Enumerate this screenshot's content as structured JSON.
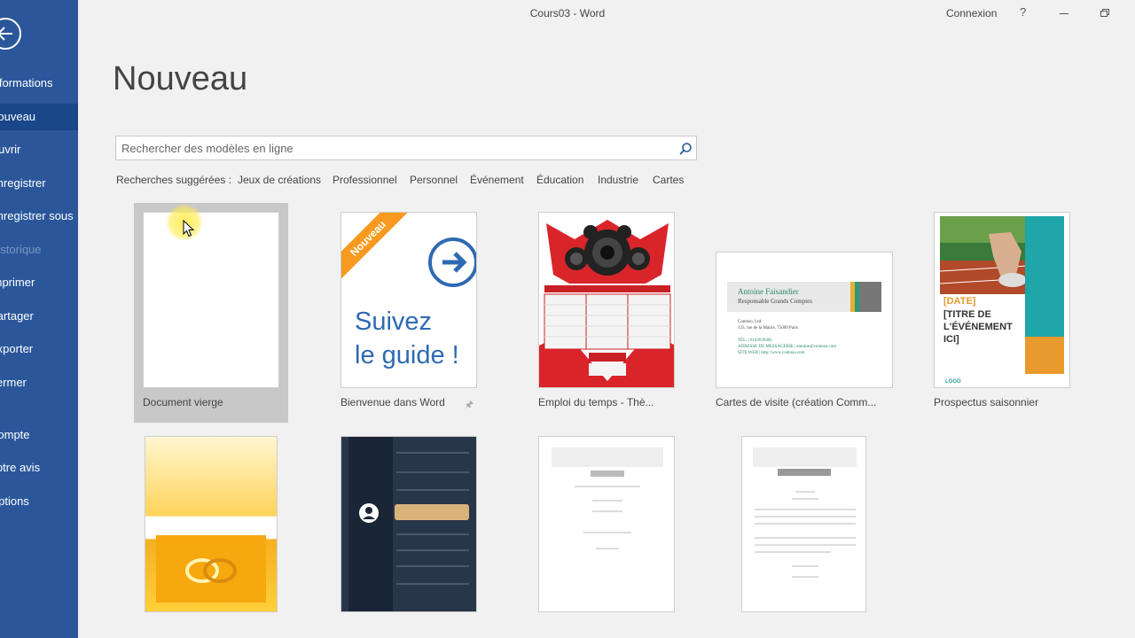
{
  "window": {
    "title": "Cours03  -  Word",
    "account": "Connexion",
    "help": "?"
  },
  "sidebar": {
    "items": [
      {
        "label": "Informations"
      },
      {
        "label": "Nouveau"
      },
      {
        "label": "Ouvrir"
      },
      {
        "label": "Enregistrer"
      },
      {
        "label": "Enregistrer sous"
      },
      {
        "label": "Historique"
      },
      {
        "label": "Imprimer"
      },
      {
        "label": "Partager"
      },
      {
        "label": "Exporter"
      },
      {
        "label": "Fermer"
      },
      {
        "label": "Compte"
      },
      {
        "label": "Votre avis"
      },
      {
        "label": "Options"
      }
    ]
  },
  "main": {
    "title": "Nouveau",
    "search_placeholder": "Rechercher des modèles en ligne",
    "suggested_label": "Recherches suggérées :",
    "suggestions": [
      "Jeux de créations",
      "Professionnel",
      "Personnel",
      "Événement",
      "Éducation",
      "Industrie",
      "Cartes"
    ]
  },
  "templates": [
    {
      "label": "Document vierge"
    },
    {
      "label": "Bienvenue dans Word",
      "ribbon": "Nouveau",
      "line1": "Suivez",
      "line2": "le guide !"
    },
    {
      "label": "Emploi du temps - Thè..."
    },
    {
      "label": "Cartes de visite (création Comm...",
      "name": "Antoine Faisandier",
      "role": "Responsable Grands Comptes",
      "line1": "Contoso, Ltd.",
      "line2": "123, rue de la Mairie, 75009 Paris",
      "line3": "TÉL. | 0102030405",
      "line4": "ADRESSE DE MESSAGERIE | antoine@contoso.com",
      "line5": "SITE WEB | http://www.contoso.com"
    },
    {
      "label": "Prospectus saisonnier",
      "date": "[DATE]",
      "title": "[TITRE DE L'ÉVÉNEMENT ICI]",
      "logo": "LOGO"
    }
  ],
  "colors": {
    "sidebar": "#2b579a",
    "sidebar_active": "#19478a",
    "accent_blue": "#2e6ab2",
    "accent_orange": "#f79a1f"
  }
}
